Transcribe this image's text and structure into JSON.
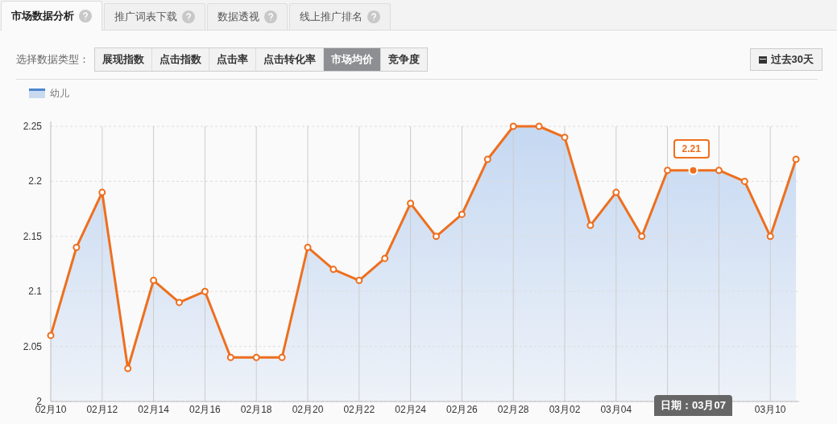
{
  "tabs": [
    {
      "label": "市场数据分析",
      "selected": true
    },
    {
      "label": "推广词表下载",
      "selected": false
    },
    {
      "label": "数据透视",
      "selected": false
    },
    {
      "label": "线上推广排名",
      "selected": false
    }
  ],
  "filter": {
    "label": "选择数据类型：",
    "options": [
      {
        "label": "展现指数",
        "selected": false
      },
      {
        "label": "点击指数",
        "selected": false
      },
      {
        "label": "点击率",
        "selected": false
      },
      {
        "label": "点击转化率",
        "selected": false
      },
      {
        "label": "市场均价",
        "selected": true
      },
      {
        "label": "竞争度",
        "selected": false
      }
    ]
  },
  "date_range_button": "过去30天",
  "chart_data": {
    "type": "area",
    "categories": [
      "02月10",
      null,
      "02月12",
      null,
      "02月14",
      null,
      "02月16",
      null,
      "02月18",
      null,
      "02月20",
      null,
      "02月22",
      null,
      "02月24",
      null,
      "02月26",
      null,
      "02月28",
      null,
      "03月02",
      null,
      "03月04",
      null,
      null,
      null,
      null,
      null,
      "03月10",
      null
    ],
    "grid": true,
    "series": [
      {
        "name": "幼儿",
        "color": "#ee6f1e",
        "values": [
          2.06,
          2.14,
          2.19,
          2.03,
          2.11,
          2.09,
          2.1,
          2.04,
          2.04,
          2.04,
          2.14,
          2.12,
          2.11,
          2.13,
          2.18,
          2.15,
          2.17,
          2.22,
          2.25,
          2.25,
          2.24,
          2.16,
          2.19,
          2.15,
          2.21,
          2.21,
          2.21,
          2.2,
          2.15,
          2.22
        ]
      }
    ],
    "ylim": [
      2,
      2.25
    ],
    "yticks": [
      {
        "value": 2,
        "label": "2"
      },
      {
        "value": 2.05,
        "label": "2.05"
      },
      {
        "value": 2.1,
        "label": "2.1"
      },
      {
        "value": 2.15,
        "label": "2.15"
      },
      {
        "value": 2.2,
        "label": "2.2"
      },
      {
        "value": 2.25,
        "label": "2.25"
      }
    ],
    "annotations": [
      {
        "y": 2.21,
        "text": "2.21"
      }
    ]
  },
  "date_tooltip": "日期：03月07"
}
